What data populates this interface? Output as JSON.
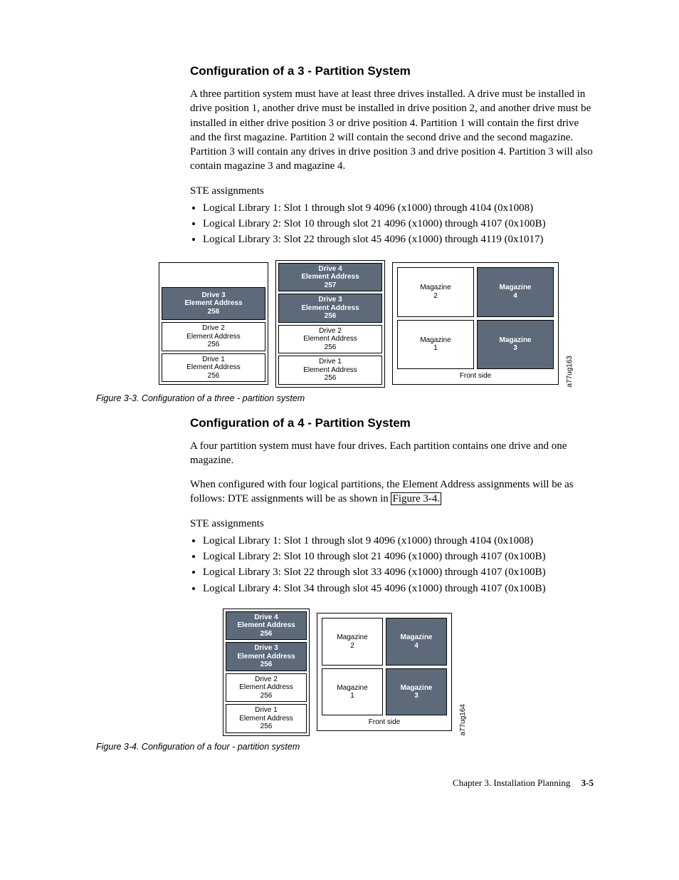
{
  "section3": {
    "title": "Configuration of a 3 - Partition System",
    "para1": "A three partition system must have at least three drives installed. A drive must be installed in drive position 1, another drive must be installed in drive position 2, and another drive must be installed in either drive position 3 or drive position 4. Partition 1 will contain the first drive and the first magazine. Partition 2 will contain the second drive and the second magazine. Partition 3 will contain any drives in drive position 3 and drive position 4. Partition 3 will also contain magazine 3 and magazine 4.",
    "ste_label": "STE assignments",
    "bullets": [
      "Logical Library 1: Slot 1 through slot 9 4096 (x1000) through 4104 (0x1008)",
      "Logical Library 2: Slot 10 through slot 21 4096 (x1000) through 4107 (0x100B)",
      "Logical Library 3: Slot 22 through slot 45 4096 (x1000) through 4119 (0x1017)"
    ],
    "figure": {
      "leftcol": {
        "d3": "Drive 3\nElement Address\n256",
        "d2": "Drive 2\nElement Address\n256",
        "d1": "Drive 1\nElement Address\n256"
      },
      "midcol": {
        "d4": "Drive 4\nElement Address\n257",
        "d3": "Drive 3\nElement Address\n256",
        "d2": "Drive 2\nElement Address\n256",
        "d1": "Drive 1\nElement Address\n256"
      },
      "mags": {
        "m2": "Magazine\n2",
        "m4": "Magazine\n4",
        "m1": "Magazine\n1",
        "m3": "Magazine\n3",
        "front": "Front side"
      },
      "side_id": "a77ug163"
    },
    "fig_caption": "Figure 3-3. Configuration of a three - partition system"
  },
  "section4": {
    "title": "Configuration of a 4 - Partition System",
    "para1": "A four partition system must have four drives. Each partition contains one drive and one magazine.",
    "para2a": "When configured with four logical partitions, the Element Address assignments will be as follows: DTE assignments will be as shown in ",
    "para2_link": "Figure 3-4.",
    "ste_label": "STE assignments",
    "bullets": [
      "Logical Library 1: Slot 1 through slot 9 4096 (x1000) through 4104 (0x1008)",
      "Logical Library 2: Slot 10 through slot 21 4096 (x1000) through 4107 (0x100B)",
      "Logical Library 3: Slot 22 through slot 33 4096 (x1000) through 4107 (0x100B)",
      "Logical Library 4: Slot 34 through slot 45 4096 (x1000) through 4107 (0x100B)"
    ],
    "figure": {
      "col": {
        "d4": "Drive 4\nElement Address\n256",
        "d3": "Drive 3\nElement Address\n256",
        "d2": "Drive 2\nElement Address\n256",
        "d1": "Drive 1\nElement Address\n256"
      },
      "mags": {
        "m2": "Magazine\n2",
        "m4": "Magazine\n4",
        "m1": "Magazine\n1",
        "m3": "Magazine\n3",
        "front": "Front side"
      },
      "side_id": "a77ug164"
    },
    "fig_caption": "Figure 3-4. Configuration of a four - partition system"
  },
  "footer": {
    "chapter": "Chapter 3. Installation Planning",
    "page": "3-5"
  }
}
